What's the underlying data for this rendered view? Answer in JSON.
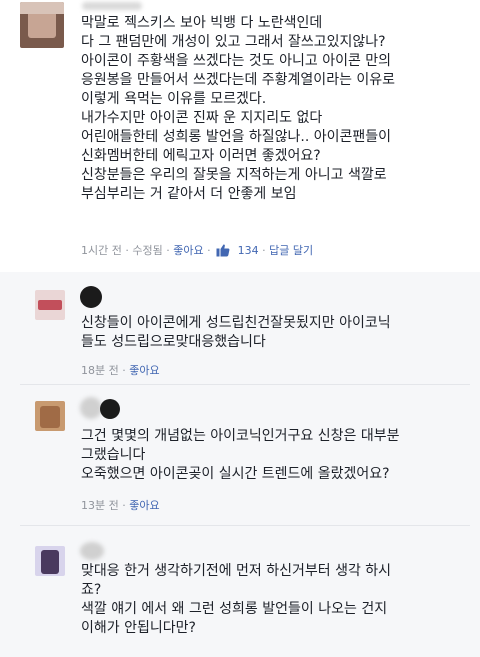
{
  "main_comment": {
    "lines": [
      "막말로 젝스키스 보아 빅뱅 다 노란색인데",
      "다 그 팬덤만에 개성이 있고 그래서 잘쓰고있지않나?",
      "아이콘이 주황색을 쓰겠다는 것도 아니고 아이콘 만의",
      "응원봉을 만들어서 쓰겠다는데 주황계열이라는 이유로",
      "이렇게 욕먹는 이유를 모르겠다.",
      "내가수지만 아이콘 진짜 운 지지리도 없다",
      "어린애들한테 성희롱 발언을 하질않나.. 아이콘팬들이",
      "신화멤버한테 에릭고자 이러면 좋겠어요?",
      "신창분들은 우리의 잘못을 지적하는게 아니고 색깔로",
      "부심부리는 거 같아서 더 안좋게 보임"
    ],
    "time": "1시간 전",
    "edited": "수정됨",
    "like": "좋아요",
    "like_count": "134",
    "reply": "답글 달기",
    "sep": "·"
  },
  "replies": [
    {
      "lines": [
        "신창들이 아이콘에게 성드립친건잘못됬지만 아이코닉",
        "들도 성드립으로맞대응했습니다"
      ],
      "time": "18분 전",
      "like": "좋아요"
    },
    {
      "lines": [
        "그건 몇몇의 개념없는 아이코닉인거구요 신창은 대부분",
        "그랬습니다",
        "오죽했으면 아이콘곶이 실시간 트렌드에 올랐겠어요?"
      ],
      "time": "13분 전",
      "like": "좋아요"
    },
    {
      "lines": [
        "맞대응 한거 생각하기전에 먼저 하신거부터 생각 하시",
        "죠?",
        "색깔 얘기 에서 왜 그런 성희롱 발언들이 나오는 건지",
        "이해가 안됩니다만?"
      ]
    }
  ],
  "colors": {
    "link": "#4267b2",
    "meta": "#90949c",
    "reply_bg": "#f6f7f9"
  }
}
